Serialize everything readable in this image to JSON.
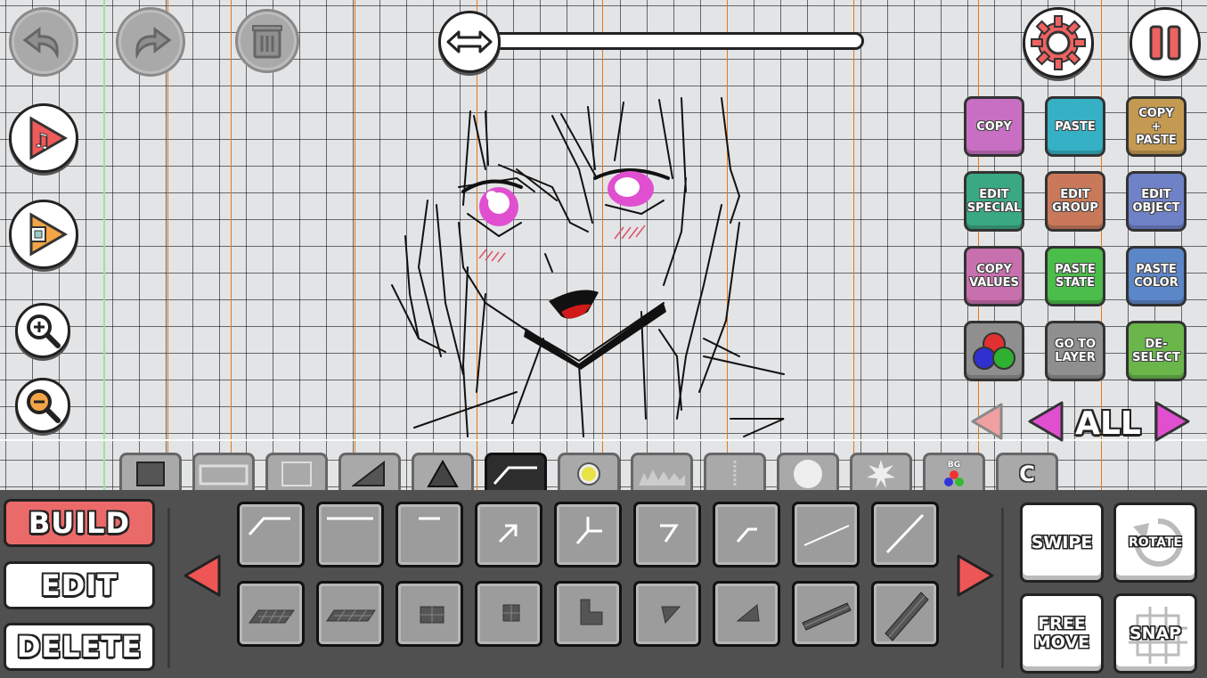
{
  "editor": {
    "action_buttons": [
      {
        "id": "copy",
        "lines": [
          "COPY"
        ],
        "color": "#c86fc4"
      },
      {
        "id": "paste",
        "lines": [
          "PASTE"
        ],
        "color": "#35b0c4"
      },
      {
        "id": "copy-paste",
        "lines": [
          "COPY",
          "+",
          "PASTE"
        ],
        "color": "#c49a52"
      },
      {
        "id": "edit-special",
        "lines": [
          "EDIT",
          "SPECIAL"
        ],
        "color": "#3aa882"
      },
      {
        "id": "edit-group",
        "lines": [
          "EDIT",
          "GROUP"
        ],
        "color": "#c9795a"
      },
      {
        "id": "edit-object",
        "lines": [
          "EDIT",
          "OBJECT"
        ],
        "color": "#6f82c8"
      },
      {
        "id": "copy-values",
        "lines": [
          "COPY",
          "VALUES"
        ],
        "color": "#c86fae"
      },
      {
        "id": "paste-state",
        "lines": [
          "PASTE",
          "STATE"
        ],
        "color": "#4bbd4a"
      },
      {
        "id": "paste-color",
        "lines": [
          "PASTE",
          "COLOR"
        ],
        "color": "#5b86c8"
      },
      {
        "id": "colors",
        "lines": [],
        "color": "#8f8f8f"
      },
      {
        "id": "go-to-layer",
        "lines": [
          "GO TO",
          "LAYER"
        ],
        "color": "#8f8f8f"
      },
      {
        "id": "deselect",
        "lines": [
          "DE-",
          "SELECT"
        ],
        "color": "#6ab64a"
      }
    ],
    "layer_label": "ALL",
    "category_tab_bg": "BG",
    "category_tab_c": "C",
    "modes": {
      "build": "BUILD",
      "edit": "EDIT",
      "delete": "DELETE"
    },
    "side_buttons": {
      "swipe": "SWIPE",
      "rotate": "ROTATE",
      "free_move": [
        "FREE",
        "MOVE"
      ],
      "snap": "SNAP"
    },
    "colors": {
      "build_active": "#ea6a6a",
      "accent_pink": "#e04fcf",
      "arrow_red": "#ee5555"
    }
  }
}
